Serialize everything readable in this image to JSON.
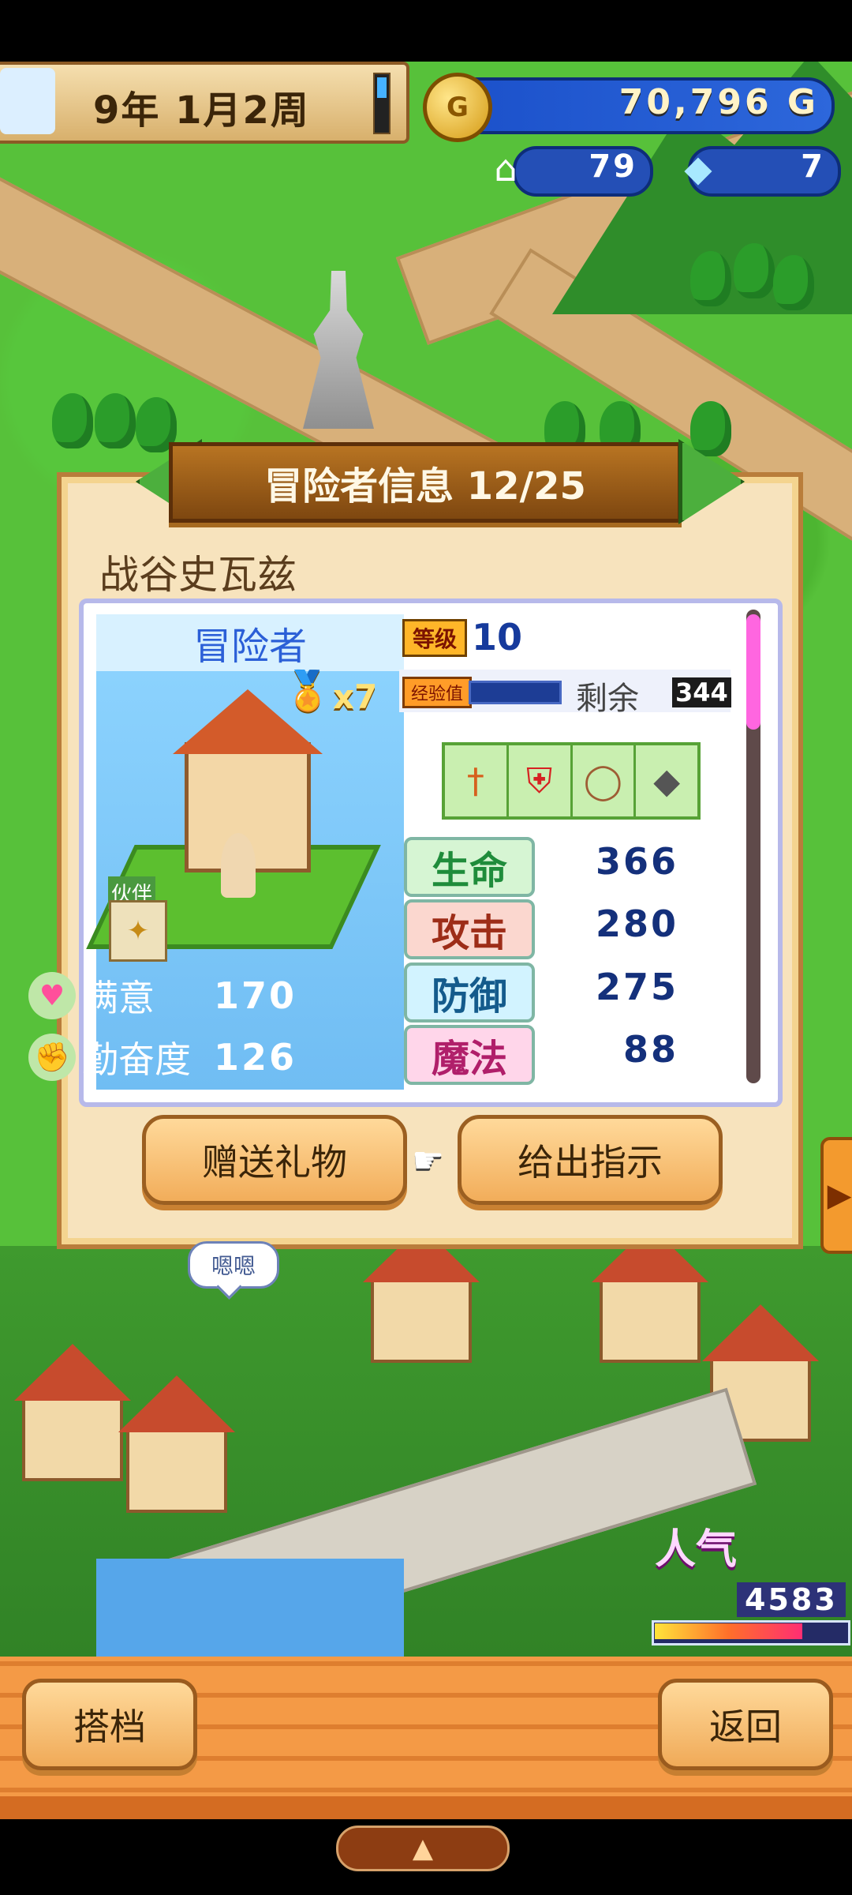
{
  "hud": {
    "date_text": "9年 1月2周",
    "gold_value": "70,796 G",
    "coin_symbol": "G",
    "house_count": "79",
    "crystal_count": "7"
  },
  "dialog": {
    "title": "冒险者信息 12/25",
    "name": "战谷史瓦兹",
    "class_label": "冒险者",
    "medal_count": "x7",
    "partner_label": "伙伴",
    "left_stats": [
      {
        "label": "满意",
        "value": "170"
      },
      {
        "label": "勤奋度",
        "value": "126"
      }
    ],
    "level_badge": "等级",
    "level_value": "10",
    "exp_badge": "经验值",
    "remaining_label": "剩余",
    "remaining_value": "344",
    "equipment_icons": [
      "sword-icon",
      "armor-icon",
      "ring-icon",
      "accessory-icon"
    ],
    "stats": [
      {
        "label": "生命",
        "value": "366"
      },
      {
        "label": "攻击",
        "value": "280"
      },
      {
        "label": "防御",
        "value": "275"
      },
      {
        "label": "魔法",
        "value": "88"
      }
    ],
    "gift_button": "赠送礼物",
    "command_button": "给出指示"
  },
  "map": {
    "speech_bubble": "嗯嗯",
    "popularity_label": "人气",
    "popularity_value": "4583",
    "popularity_fill": 0.78
  },
  "bottom": {
    "partner_button": "搭档",
    "back_button": "返回"
  }
}
